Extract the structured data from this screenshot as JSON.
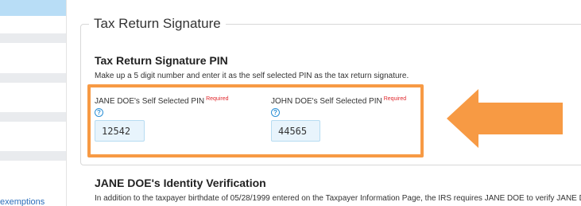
{
  "sidebar": {
    "link_text": "exemptions"
  },
  "section": {
    "legend": "Tax Return Signature",
    "pin_title": "Tax Return Signature PIN",
    "pin_description": "Make up a 5 digit number and enter it as the self selected PIN as the tax return signature."
  },
  "fields": [
    {
      "label": "JANE DOE's Self Selected PIN",
      "required": "Required",
      "help": "?",
      "value": "12542"
    },
    {
      "label": "JOHN DOE's Self Selected PIN",
      "required": "Required",
      "help": "?",
      "value": "44565"
    }
  ],
  "identity": {
    "title": "JANE DOE's Identity Verification",
    "text": "In addition to the taxpayer birthdate of 05/28/1999 entered on the Taxpayer Information Page, the IRS requires JANE DOE to verify JANE D"
  },
  "colors": {
    "accent_orange": "#f79a44",
    "required_red": "#e0292e",
    "input_bg": "#e8f4fc",
    "link_blue": "#2a6ebb"
  }
}
